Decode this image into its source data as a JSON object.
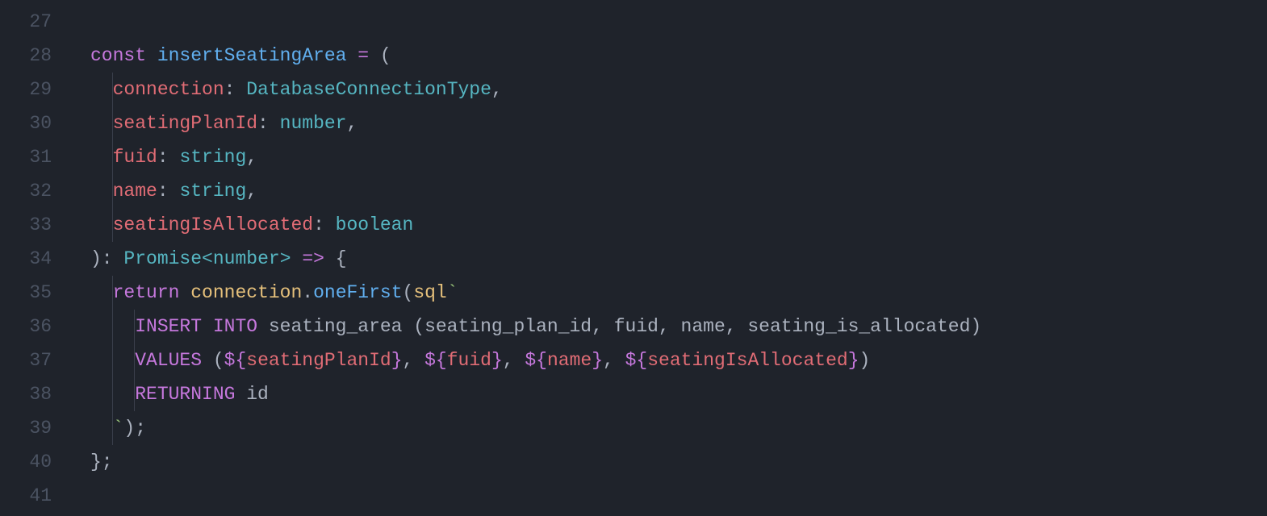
{
  "colors": {
    "background": "#1f232b",
    "gutter_fg": "#4b5362",
    "default_fg": "#abb2bf",
    "keyword": "#c678dd",
    "function": "#61afef",
    "definition": "#e06c75",
    "variable": "#e5c07b",
    "type": "#56b6c2",
    "string": "#98c379",
    "indent_guide": "#3a3f4b"
  },
  "editor": {
    "first_line_number": 27,
    "lines": [
      {
        "number": 27,
        "indent_guides": [],
        "tokens": [
          {
            "t": "",
            "c": "tk-plain"
          }
        ]
      },
      {
        "number": 28,
        "indent_guides": [],
        "tokens": [
          {
            "t": "const",
            "c": "tk-keyword"
          },
          {
            "t": " ",
            "c": "tk-plain"
          },
          {
            "t": "insertSeatingArea",
            "c": "tk-func"
          },
          {
            "t": " ",
            "c": "tk-plain"
          },
          {
            "t": "=",
            "c": "tk-op"
          },
          {
            "t": " (",
            "c": "tk-punct"
          }
        ]
      },
      {
        "number": 29,
        "indent_guides": [
          2
        ],
        "tokens": [
          {
            "t": "  ",
            "c": "tk-plain"
          },
          {
            "t": "connection",
            "c": "tk-def"
          },
          {
            "t": ": ",
            "c": "tk-punct"
          },
          {
            "t": "DatabaseConnectionType",
            "c": "tk-type"
          },
          {
            "t": ",",
            "c": "tk-punct"
          }
        ]
      },
      {
        "number": 30,
        "indent_guides": [
          2
        ],
        "tokens": [
          {
            "t": "  ",
            "c": "tk-plain"
          },
          {
            "t": "seatingPlanId",
            "c": "tk-def"
          },
          {
            "t": ": ",
            "c": "tk-punct"
          },
          {
            "t": "number",
            "c": "tk-type"
          },
          {
            "t": ",",
            "c": "tk-punct"
          }
        ]
      },
      {
        "number": 31,
        "indent_guides": [
          2
        ],
        "tokens": [
          {
            "t": "  ",
            "c": "tk-plain"
          },
          {
            "t": "fuid",
            "c": "tk-def"
          },
          {
            "t": ": ",
            "c": "tk-punct"
          },
          {
            "t": "string",
            "c": "tk-type"
          },
          {
            "t": ",",
            "c": "tk-punct"
          }
        ]
      },
      {
        "number": 32,
        "indent_guides": [
          2
        ],
        "tokens": [
          {
            "t": "  ",
            "c": "tk-plain"
          },
          {
            "t": "name",
            "c": "tk-def"
          },
          {
            "t": ": ",
            "c": "tk-punct"
          },
          {
            "t": "string",
            "c": "tk-type"
          },
          {
            "t": ",",
            "c": "tk-punct"
          }
        ]
      },
      {
        "number": 33,
        "indent_guides": [
          2
        ],
        "tokens": [
          {
            "t": "  ",
            "c": "tk-plain"
          },
          {
            "t": "seatingIsAllocated",
            "c": "tk-def"
          },
          {
            "t": ": ",
            "c": "tk-punct"
          },
          {
            "t": "boolean",
            "c": "tk-type"
          }
        ]
      },
      {
        "number": 34,
        "indent_guides": [],
        "tokens": [
          {
            "t": "): ",
            "c": "tk-punct"
          },
          {
            "t": "Promise",
            "c": "tk-type"
          },
          {
            "t": "<",
            "c": "tk-op2"
          },
          {
            "t": "number",
            "c": "tk-type"
          },
          {
            "t": ">",
            "c": "tk-op2"
          },
          {
            "t": " ",
            "c": "tk-plain"
          },
          {
            "t": "=>",
            "c": "tk-op"
          },
          {
            "t": " {",
            "c": "tk-punct"
          }
        ]
      },
      {
        "number": 35,
        "indent_guides": [
          2
        ],
        "tokens": [
          {
            "t": "  ",
            "c": "tk-plain"
          },
          {
            "t": "return",
            "c": "tk-keyword"
          },
          {
            "t": " ",
            "c": "tk-plain"
          },
          {
            "t": "connection",
            "c": "tk-var"
          },
          {
            "t": ".",
            "c": "tk-punct"
          },
          {
            "t": "oneFirst",
            "c": "tk-func"
          },
          {
            "t": "(",
            "c": "tk-punct"
          },
          {
            "t": "sql",
            "c": "tk-fn-id"
          },
          {
            "t": "`",
            "c": "tk-str"
          }
        ]
      },
      {
        "number": 36,
        "indent_guides": [
          2,
          4
        ],
        "tokens": [
          {
            "t": "    ",
            "c": "tk-str"
          },
          {
            "t": "INSERT INTO",
            "c": "tk-sql-kw"
          },
          {
            "t": " seating_area (seating_plan_id, fuid, name, seating_is_allocated)",
            "c": "tk-plain"
          }
        ]
      },
      {
        "number": 37,
        "indent_guides": [
          2,
          4
        ],
        "tokens": [
          {
            "t": "    ",
            "c": "tk-str"
          },
          {
            "t": "VALUES",
            "c": "tk-sql-kw"
          },
          {
            "t": " (",
            "c": "tk-plain"
          },
          {
            "t": "${",
            "c": "tk-interp-d"
          },
          {
            "t": "seatingPlanId",
            "c": "tk-interp-v"
          },
          {
            "t": "}",
            "c": "tk-interp-d"
          },
          {
            "t": ", ",
            "c": "tk-plain"
          },
          {
            "t": "${",
            "c": "tk-interp-d"
          },
          {
            "t": "fuid",
            "c": "tk-interp-v"
          },
          {
            "t": "}",
            "c": "tk-interp-d"
          },
          {
            "t": ", ",
            "c": "tk-plain"
          },
          {
            "t": "${",
            "c": "tk-interp-d"
          },
          {
            "t": "name",
            "c": "tk-interp-v"
          },
          {
            "t": "}",
            "c": "tk-interp-d"
          },
          {
            "t": ", ",
            "c": "tk-plain"
          },
          {
            "t": "${",
            "c": "tk-interp-d"
          },
          {
            "t": "seatingIsAllocated",
            "c": "tk-interp-v"
          },
          {
            "t": "}",
            "c": "tk-interp-d"
          },
          {
            "t": ")",
            "c": "tk-plain"
          }
        ]
      },
      {
        "number": 38,
        "indent_guides": [
          2,
          4
        ],
        "tokens": [
          {
            "t": "    ",
            "c": "tk-str"
          },
          {
            "t": "RETURNING",
            "c": "tk-sql-kw"
          },
          {
            "t": " id",
            "c": "tk-plain"
          }
        ]
      },
      {
        "number": 39,
        "indent_guides": [
          2
        ],
        "tokens": [
          {
            "t": "  ",
            "c": "tk-str"
          },
          {
            "t": "`",
            "c": "tk-str"
          },
          {
            "t": ");",
            "c": "tk-punct"
          }
        ]
      },
      {
        "number": 40,
        "indent_guides": [],
        "tokens": [
          {
            "t": "};",
            "c": "tk-punct"
          }
        ]
      },
      {
        "number": 41,
        "indent_guides": [],
        "tokens": [
          {
            "t": "",
            "c": "tk-plain"
          }
        ]
      }
    ]
  }
}
